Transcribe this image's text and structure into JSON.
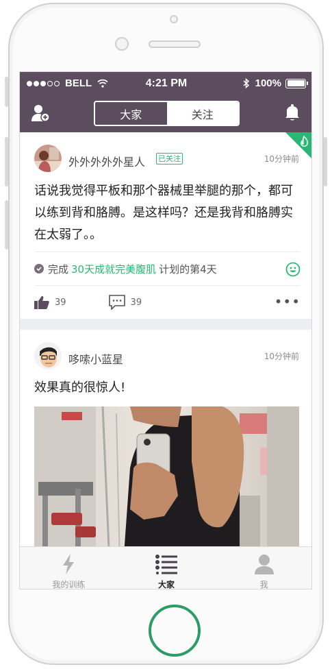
{
  "status_bar": {
    "carrier": "BELL",
    "time": "4:21 PM",
    "battery": "100%"
  },
  "nav": {
    "segments": [
      "大家",
      "关注"
    ],
    "active_segment": "大家"
  },
  "posts": [
    {
      "username": "外外外外外星人",
      "follow_badge": "已关注",
      "timestamp": "10分钟前",
      "content": "话说我觉得平板和那个器械里举腿的那个，都可以练到背和胳膊。是这样吗？还是我背和胳膊实在太弱了。。",
      "plan_prefix": "完成",
      "plan_name": "30天成就完美腹肌",
      "plan_suffix": "计划的第4天",
      "likes": "39",
      "comments": "39",
      "hot": true
    },
    {
      "username": "哆嗦小蓝星",
      "timestamp": "10分钟前",
      "content": "效果真的很惊人!"
    }
  ],
  "tabs": [
    "我的训练",
    "大家",
    "我"
  ],
  "active_tab": "大家",
  "colors": {
    "header": "#5b4d5e",
    "accent_green": "#2bb673",
    "home_button": "#2b9c63"
  },
  "icons": [
    "add-friend-icon",
    "bell-icon",
    "flame-icon",
    "check-icon",
    "smile-icon",
    "thumbs-up-icon",
    "comment-icon",
    "more-icon",
    "lightning-icon",
    "list-icon",
    "person-icon"
  ]
}
